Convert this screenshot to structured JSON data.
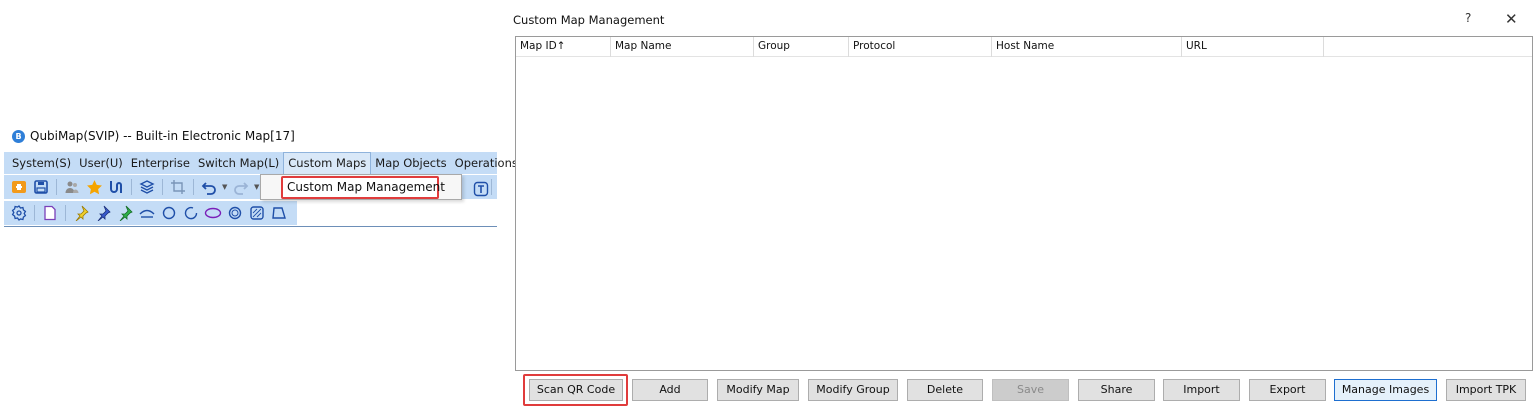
{
  "app": {
    "title": "QubiMap(SVIP) -- Built-in Electronic Map[17]",
    "logo_glyph": "B"
  },
  "menubar": {
    "items": [
      {
        "label": "System(S)"
      },
      {
        "label": "User(U)"
      },
      {
        "label": "Enterprise"
      },
      {
        "label": "Switch Map(L)"
      },
      {
        "label": "Custom Maps",
        "active": true
      },
      {
        "label": "Map Objects"
      },
      {
        "label": "Operations(O)"
      }
    ]
  },
  "submenu": {
    "item_label": "Custom Map Management"
  },
  "toolbar_icons": {
    "row1": [
      "open-folder-icon",
      "save-icon",
      "users-icon",
      "favorite-star-icon",
      "route-icon",
      "layers-icon",
      "crop-icon",
      "undo-icon",
      "redo-icon",
      "text-icon"
    ],
    "row2": [
      "settings-icon",
      "page-icon",
      "pin-yellow-icon",
      "pin-blue-icon",
      "pin-green-icon",
      "arc-icon",
      "circle-icon",
      "arc-open-icon",
      "ellipse-icon",
      "circle-dot-icon",
      "rectangle-icon",
      "polygon-icon"
    ]
  },
  "colors": {
    "toolbar_bg": "#c4dcf6",
    "highlight": "#e03c3c",
    "focus": "#1e6fd0"
  },
  "dialog": {
    "title": "Custom Map Management",
    "help_label": "?",
    "close_label": "✕",
    "columns": [
      "Map ID↑",
      "Map Name",
      "Group",
      "Protocol",
      "Host Name",
      "URL",
      ""
    ],
    "rows": [],
    "buttons": {
      "scan_qr": "Scan QR Code",
      "add": "Add",
      "modify_map": "Modify Map",
      "modify_group": "Modify Group",
      "delete": "Delete",
      "save": "Save",
      "share": "Share",
      "import": "Import",
      "export": "Export",
      "manage_images": "Manage Images",
      "import_tpk": "Import TPK"
    }
  }
}
